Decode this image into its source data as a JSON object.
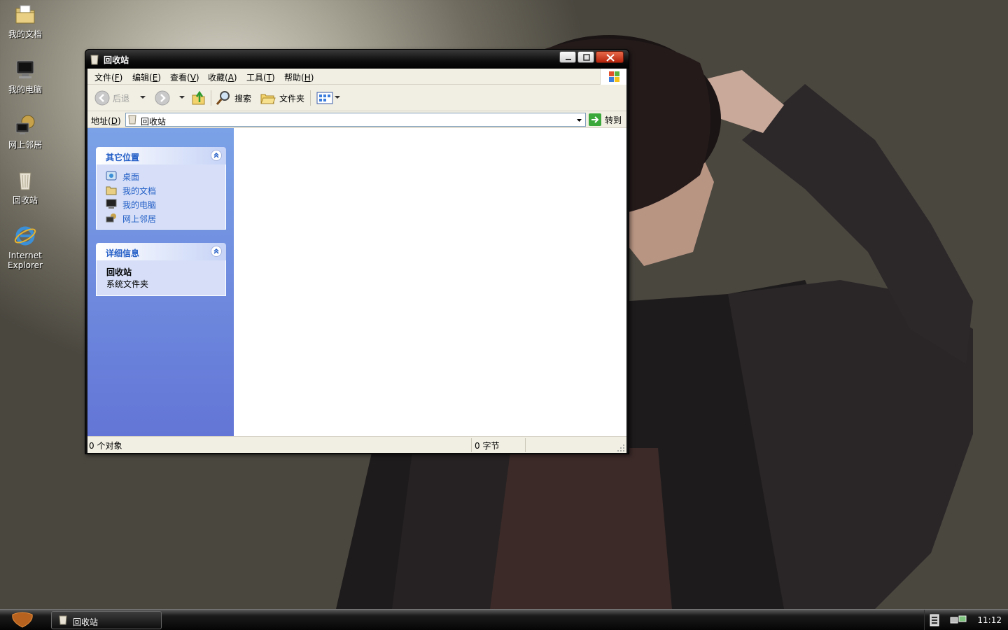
{
  "desktop": {
    "icons": [
      {
        "label": "我的文档"
      },
      {
        "label": "我的电脑"
      },
      {
        "label": "网上邻居"
      },
      {
        "label": "回收站"
      },
      {
        "label_line1": "Internet",
        "label_line2": "Explorer"
      }
    ]
  },
  "window": {
    "title": "回收站",
    "menu": [
      {
        "text": "文件",
        "key": "F"
      },
      {
        "text": "编辑",
        "key": "E"
      },
      {
        "text": "查看",
        "key": "V"
      },
      {
        "text": "收藏",
        "key": "A"
      },
      {
        "text": "工具",
        "key": "T"
      },
      {
        "text": "帮助",
        "key": "H"
      }
    ],
    "toolbar": {
      "back": "后退",
      "search": "搜索",
      "folders": "文件夹"
    },
    "address": {
      "label": "地址",
      "label_key": "D",
      "value": "回收站",
      "go": "转到"
    },
    "taskpane": {
      "other_places": {
        "title": "其它位置",
        "items": [
          {
            "label": "桌面"
          },
          {
            "label": "我的文档"
          },
          {
            "label": "我的电脑"
          },
          {
            "label": "网上邻居"
          }
        ]
      },
      "details": {
        "title": "详细信息",
        "name": "回收站",
        "type": "系统文件夹"
      }
    },
    "status": {
      "objects": "0 个对象",
      "bytes": "0 字节"
    }
  },
  "taskbar": {
    "task_label": "回收站",
    "clock": "11:12"
  },
  "colors": {
    "taskpane_link": "#215dc6",
    "taskpane_bg_top": "#7ba2e7",
    "taskpane_bg_bottom": "#6375d6",
    "titlebar": "#000000"
  }
}
